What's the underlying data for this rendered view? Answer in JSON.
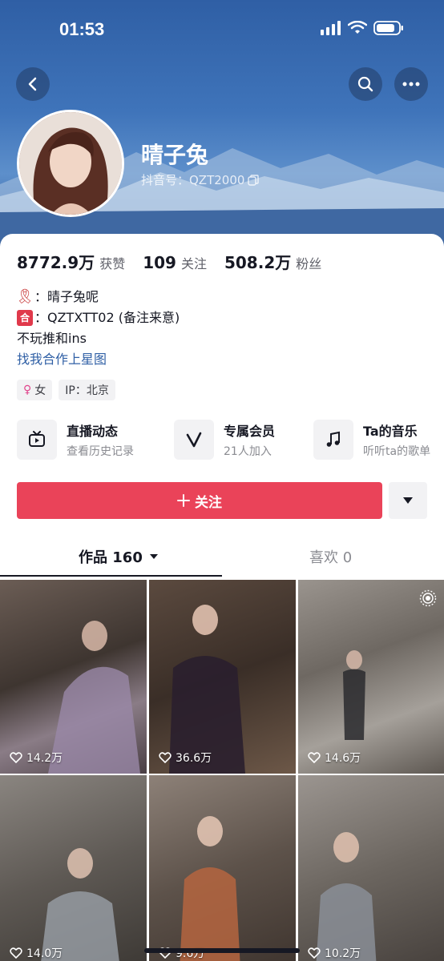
{
  "status_bar": {
    "time": "01:53"
  },
  "profile": {
    "username": "晴子兔",
    "douyin_id": "抖音号：QZT2000"
  },
  "stats": [
    {
      "value": "8772.9万",
      "label": "获赞"
    },
    {
      "value": "109",
      "label": "关注"
    },
    {
      "value": "508.2万",
      "label": "粉丝"
    }
  ],
  "bio": {
    "line1": "：晴子兔呢",
    "line2": "：QZTXTT02 (备注来意)",
    "he_badge": "合",
    "line3": "不玩推和ins",
    "link": "找我合作上星图"
  },
  "tags": {
    "gender": "女",
    "ip": "IP：北京"
  },
  "features": [
    {
      "title": "直播动态",
      "subtitle": "查看历史记录",
      "icon": "tv-icon"
    },
    {
      "title": "专属会员",
      "subtitle": "21人加入",
      "icon": "v-icon"
    },
    {
      "title": "Ta的音乐",
      "subtitle": "听听ta的歌单",
      "icon": "music-note-icon"
    }
  ],
  "follow_button": {
    "label": "关注"
  },
  "tabs": {
    "works": {
      "label": "作品 160"
    },
    "likes": {
      "label": "喜欢 0"
    }
  },
  "videos": [
    {
      "likes": "14.2万"
    },
    {
      "likes": "36.6万"
    },
    {
      "likes": "14.6万"
    },
    {
      "likes": "14.0万"
    },
    {
      "likes": "9.6万"
    },
    {
      "likes": "10.2万"
    }
  ],
  "colors": {
    "accent": "#ea4359",
    "cover": "#3f74ba",
    "link": "#2f5fa5"
  }
}
